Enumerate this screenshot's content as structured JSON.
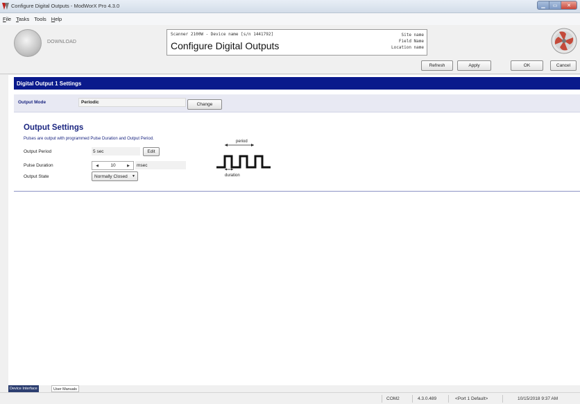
{
  "window": {
    "title": "Configure Digital Outputs - ModWorX Pro 4.3.0"
  },
  "menu": [
    {
      "key": "F",
      "rest": "ile"
    },
    {
      "key": "T",
      "rest": "asks"
    },
    {
      "key": "To",
      "rest": "ols"
    },
    {
      "key": "H",
      "rest": "elp"
    }
  ],
  "header": {
    "download_label": "DOWNLOAD",
    "device_line": "Scanner 2100W - Device name [s/n 1441792]",
    "page_title": "Configure Digital Outputs",
    "site_name": "Site name",
    "field_name": "Field Name",
    "location_name": "Location name"
  },
  "toolbar": {
    "refresh": "Refresh",
    "apply": "Apply",
    "ok": "OK",
    "cancel": "Cancel"
  },
  "section": {
    "title": "Digital Output 1 Settings",
    "mode_label": "Output Mode",
    "mode_value": "Periodic",
    "change_button": "Change"
  },
  "output_settings": {
    "title": "Output Settings",
    "description": "Pulses are output with programmed Pulse Duration and Output Period.",
    "period_label": "Output Period",
    "period_value": "5",
    "period_unit": "sec",
    "edit_button": "Edit",
    "duration_label": "Pulse Duration",
    "duration_value": "10",
    "duration_unit": "msec",
    "state_label": "Output State",
    "state_value": "Normally Closed",
    "diagram_period": "period",
    "diagram_duration": "duration"
  },
  "bottom_tabs": {
    "device_interface": "Device Interface",
    "user_manuals": "User Manuals"
  },
  "status": {
    "port": "COM2",
    "version": "4.3.0.489",
    "port_name": "<Port 1 Default>",
    "datetime": "10/15/2018 9:37 AM"
  },
  "colors": {
    "section_header": "#0a1a8c",
    "label_blue": "#1a2580"
  }
}
